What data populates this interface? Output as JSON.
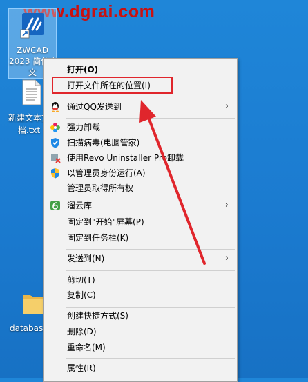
{
  "watermark": {
    "text": "www.dgrai.com"
  },
  "desktop": {
    "zwcad": {
      "line1": "ZWCAD",
      "line2": "2023 简体中",
      "line3": "文"
    },
    "newtext": {
      "line1": "新建文本文",
      "line2": "档.txt"
    },
    "database": {
      "label": "database"
    }
  },
  "menu": {
    "items": [
      {
        "label": "打开(O)",
        "icon": ""
      },
      {
        "label": "打开文件所在的位置(I)",
        "icon": ""
      },
      {
        "label": "通过QQ发送到",
        "icon": "qq-icon",
        "submenu": true
      },
      {
        "label": "强力卸载",
        "icon": "uninstall-flower-icon"
      },
      {
        "label": "扫描病毒(电脑管家)",
        "icon": "shield-icon"
      },
      {
        "label": "使用Revo Uninstaller Pro卸载",
        "icon": "revo-icon"
      },
      {
        "label": "以管理员身份运行(A)",
        "icon": "uac-shield-icon"
      },
      {
        "label": "管理员取得所有权",
        "icon": ""
      },
      {
        "label": "溜云库",
        "icon": "liuyunku-icon",
        "submenu": true
      },
      {
        "label": "固定到\"开始\"屏幕(P)",
        "icon": ""
      },
      {
        "label": "固定到任务栏(K)",
        "icon": ""
      },
      {
        "label": "发送到(N)",
        "icon": "",
        "submenu": true
      },
      {
        "label": "剪切(T)",
        "icon": ""
      },
      {
        "label": "复制(C)",
        "icon": ""
      },
      {
        "label": "创建快捷方式(S)",
        "icon": ""
      },
      {
        "label": "删除(D)",
        "icon": ""
      },
      {
        "label": "重命名(M)",
        "icon": ""
      },
      {
        "label": "属性(R)",
        "icon": ""
      }
    ],
    "submenu_arrow": "›"
  },
  "colors": {
    "annotation": "#e0262c",
    "menu_bg": "#f2f2f2",
    "desktop": "#1b7bd0"
  }
}
